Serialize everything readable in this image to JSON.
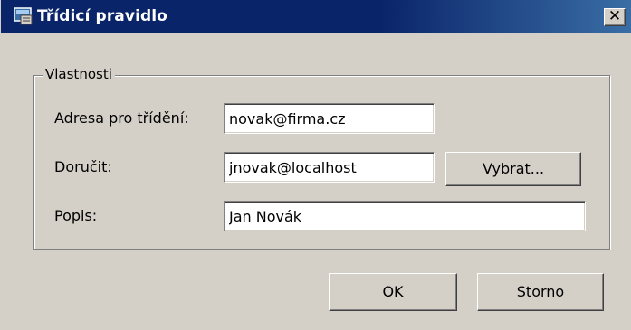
{
  "window": {
    "title": "Třídicí pravidlo",
    "close_glyph": "✕"
  },
  "group": {
    "legend": "Vlastnosti"
  },
  "fields": {
    "address_label": "Adresa pro třídění:",
    "address_value": "novak@firma.cz",
    "deliver_label": "Doručit:",
    "deliver_value": "jnovak@localhost",
    "description_label": "Popis:",
    "description_value": "Jan Novák"
  },
  "buttons": {
    "select": "Vybrat...",
    "ok": "OK",
    "cancel": "Storno"
  },
  "icons": {
    "title_icon": "window-app-icon",
    "close_icon": "close-icon"
  },
  "colors": {
    "titlebar": "#0a246a",
    "face": "#d4d0c8"
  }
}
